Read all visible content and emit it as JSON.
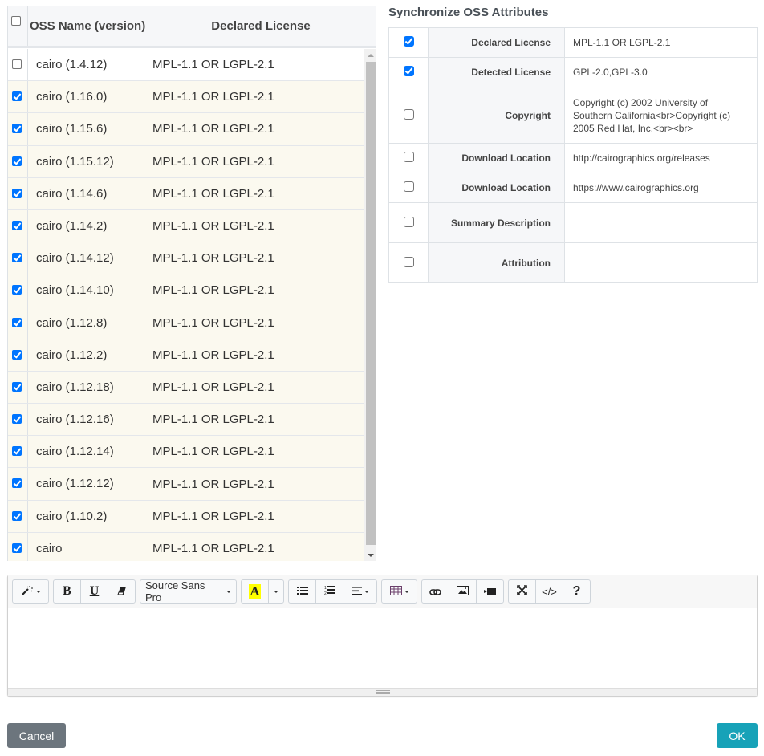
{
  "oss_list": {
    "columns": {
      "name": "OSS Name (version)",
      "license": "Declared License"
    },
    "select_all_checked": false,
    "rows": [
      {
        "name": "cairo (1.4.12)",
        "license": "MPL-1.1 OR LGPL-2.1",
        "checked": false
      },
      {
        "name": "cairo (1.16.0)",
        "license": "MPL-1.1 OR LGPL-2.1",
        "checked": true
      },
      {
        "name": "cairo (1.15.6)",
        "license": "MPL-1.1 OR LGPL-2.1",
        "checked": true
      },
      {
        "name": "cairo (1.15.12)",
        "license": "MPL-1.1 OR LGPL-2.1",
        "checked": true
      },
      {
        "name": "cairo (1.14.6)",
        "license": "MPL-1.1 OR LGPL-2.1",
        "checked": true
      },
      {
        "name": "cairo (1.14.2)",
        "license": "MPL-1.1 OR LGPL-2.1",
        "checked": true
      },
      {
        "name": "cairo (1.14.12)",
        "license": "MPL-1.1 OR LGPL-2.1",
        "checked": true
      },
      {
        "name": "cairo (1.14.10)",
        "license": "MPL-1.1 OR LGPL-2.1",
        "checked": true
      },
      {
        "name": "cairo (1.12.8)",
        "license": "MPL-1.1 OR LGPL-2.1",
        "checked": true
      },
      {
        "name": "cairo (1.12.2)",
        "license": "MPL-1.1 OR LGPL-2.1",
        "checked": true
      },
      {
        "name": "cairo (1.12.18)",
        "license": "MPL-1.1 OR LGPL-2.1",
        "checked": true
      },
      {
        "name": "cairo (1.12.16)",
        "license": "MPL-1.1 OR LGPL-2.1",
        "checked": true
      },
      {
        "name": "cairo (1.12.14)",
        "license": "MPL-1.1 OR LGPL-2.1",
        "checked": true
      },
      {
        "name": "cairo (1.12.12)",
        "license": "MPL-1.1 OR LGPL-2.1",
        "checked": true
      },
      {
        "name": "cairo (1.10.2)",
        "license": "MPL-1.1 OR LGPL-2.1",
        "checked": true
      },
      {
        "name": "cairo",
        "license": "MPL-1.1 OR LGPL-2.1",
        "checked": true
      }
    ]
  },
  "sync": {
    "title": "Synchronize OSS Attributes",
    "rows": [
      {
        "label": "Declared License",
        "value": "MPL-1.1 OR LGPL-2.1",
        "checked": true
      },
      {
        "label": "Detected License",
        "value": "GPL-2.0,GPL-3.0",
        "checked": true
      },
      {
        "label": "Copyright",
        "value": "Copyright (c) 2002 University of Southern California<br>Copyright (c) 2005 Red Hat, Inc.<br><br>",
        "checked": false
      },
      {
        "label": "Download Location",
        "value": "http://cairographics.org/releases",
        "checked": false
      },
      {
        "label": "Download Location",
        "value": "https://www.cairographics.org",
        "checked": false
      },
      {
        "label": "Summary Description",
        "value": "",
        "checked": false
      },
      {
        "label": "Attribution",
        "value": "",
        "checked": false
      }
    ]
  },
  "editor": {
    "font_name": "Source Sans Pro",
    "toolbar_icons": {
      "magic": "magic-wand-icon",
      "bold": "B",
      "underline": "U",
      "eraser": "eraser-icon",
      "font_color": "A",
      "unordered_list": "unordered-list-icon",
      "ordered_list": "ordered-list-icon",
      "align": "align-icon",
      "table": "table-icon",
      "link": "link-icon",
      "picture": "picture-icon",
      "video": "video-icon",
      "fullscreen": "fullscreen-icon",
      "code": "</>",
      "help": "?"
    },
    "highlight_color": "#ffff00",
    "content": ""
  },
  "buttons": {
    "cancel": "Cancel",
    "ok": "OK"
  },
  "colors": {
    "checked_row_bg": "#fbf9ef",
    "checkbox_accent": "#0075ff",
    "ok_button": "#17a2b8",
    "cancel_button": "#6c757d"
  }
}
